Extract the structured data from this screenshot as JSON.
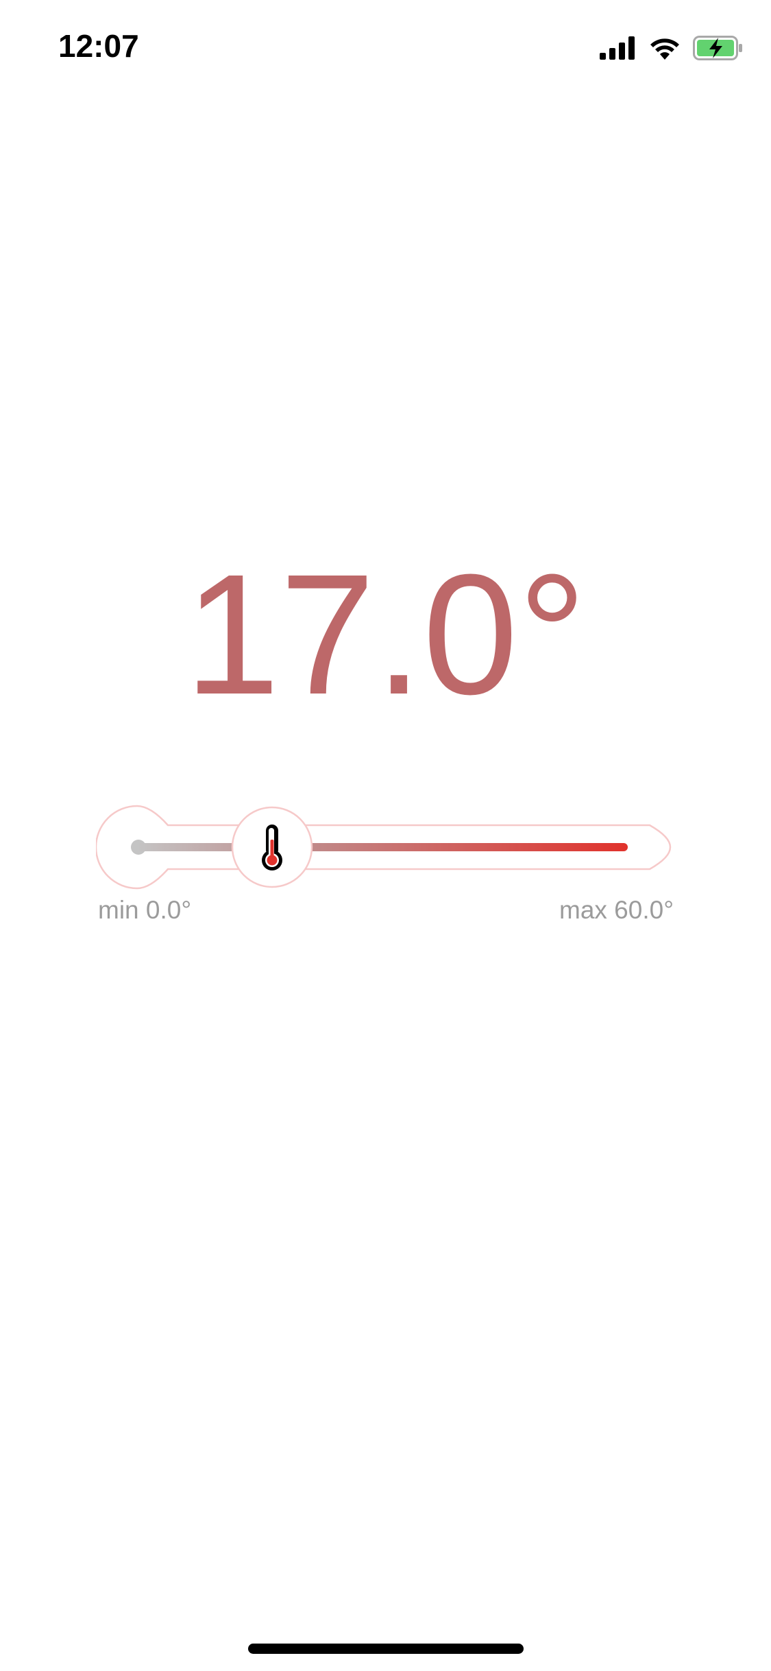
{
  "status_bar": {
    "time": "12:07",
    "icons": [
      "signal-icon",
      "wifi-icon",
      "battery-charging-icon"
    ]
  },
  "temperature": {
    "display": "17.0°",
    "value": 17.0,
    "min": 0.0,
    "max": 60.0,
    "min_label": "min 0.0°",
    "max_label": "max 60.0°",
    "color": "#bd6869"
  },
  "slider": {
    "track_start_color": "#c4c4c4",
    "track_end_color": "#e0332d",
    "outline_color": "#f6c9c9",
    "knob_icon": "thermometer-icon"
  },
  "colors": {
    "battery_fill": "#62d26f"
  }
}
